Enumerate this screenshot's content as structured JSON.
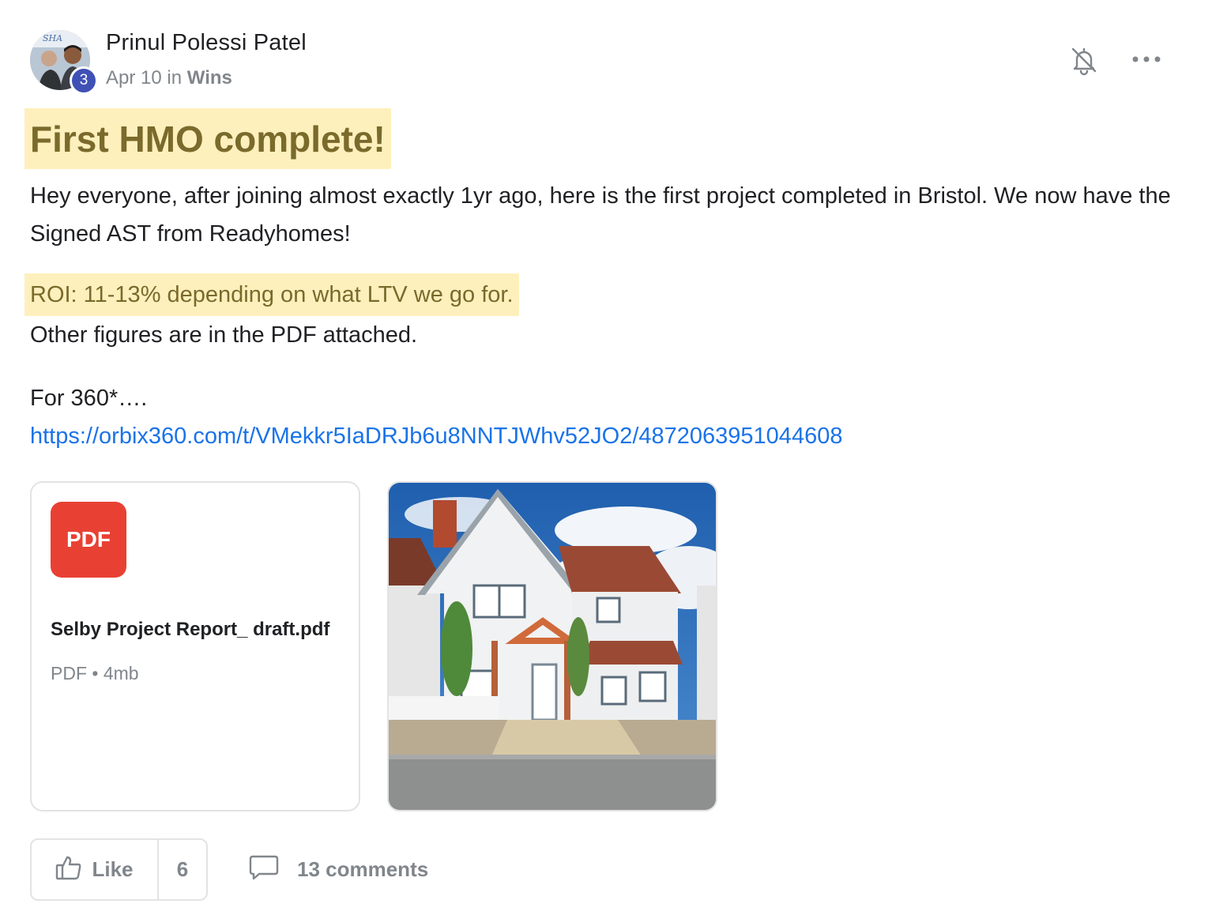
{
  "post": {
    "author": "Prinul Polessi Patel",
    "level_badge": "3",
    "date": "Apr 10",
    "in_word": "in",
    "category": "Wins",
    "avatar_caption": "SHA",
    "title": "First HMO complete!",
    "paragraph_1": "Hey everyone, after joining almost exactly 1yr ago, here is the first project completed in Bristol. We now have the Signed AST from Readyhomes!",
    "roi_line": "ROI: 11-13% depending on what LTV we go for.",
    "paragraph_2": "Other figures are in the PDF attached.",
    "paragraph_3": "For 360*….",
    "link": "https://orbix360.com/t/VMekkr5IaDRJb6u8NNTJWhv52JO2/4872063951044608"
  },
  "attachments": {
    "pdf": {
      "icon_label": "PDF",
      "file_name": "Selby Project Report_ draft.pdf",
      "file_meta": "PDF • 4mb"
    }
  },
  "actions": {
    "like_label": "Like",
    "like_count": "6",
    "comments_label": "13 comments"
  },
  "icons": {
    "bell": "bell-off-icon",
    "more": "more-horizontal-icon",
    "like": "thumbs-up-icon",
    "comment": "comment-icon"
  },
  "colors": {
    "highlight_bg": "#fef0bd",
    "highlight_text": "#7a6a2b",
    "link": "#1a73e8",
    "pdf_red": "#e84134",
    "badge_blue": "#3f51b5",
    "muted": "#80868b"
  }
}
